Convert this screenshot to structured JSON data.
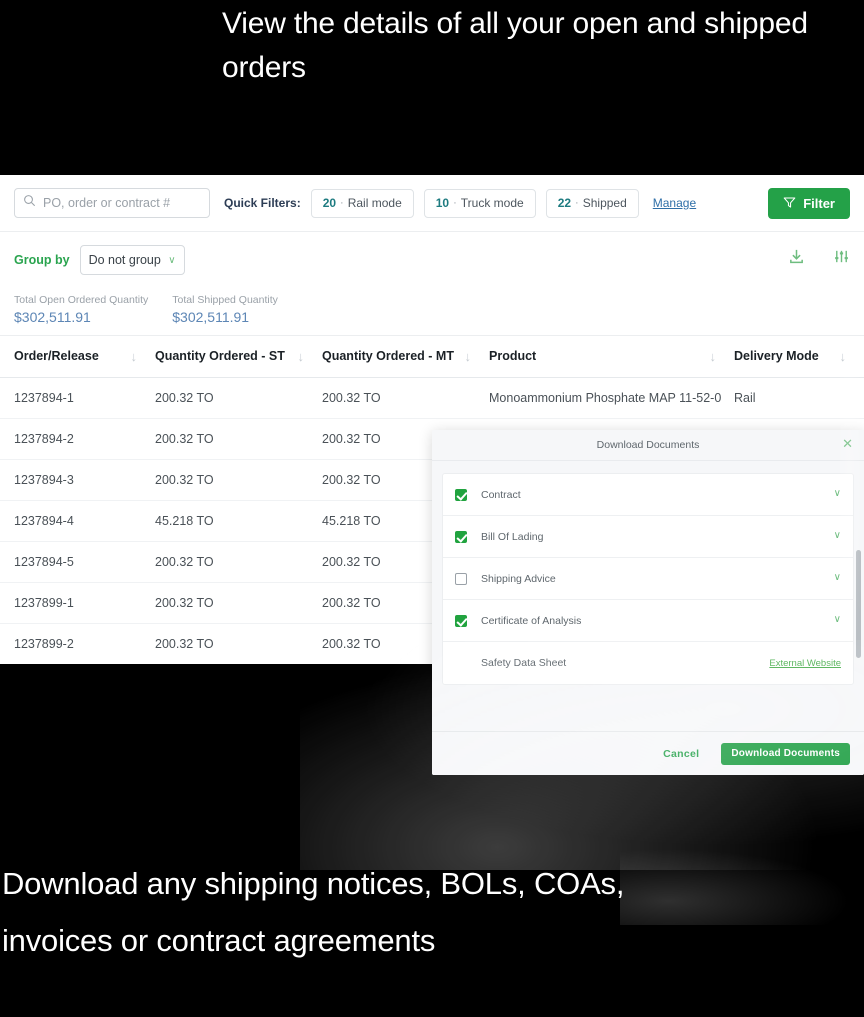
{
  "captions": {
    "top": "View the details of all your open and shipped orders",
    "bottom": "Download any shipping notices, BOLs, COAs, invoices or contract agreements"
  },
  "colors": {
    "brand_green": "#24a148",
    "link_green": "#4caf50",
    "link_blue": "#2f6fa8",
    "total_blue": "#5d86b5",
    "count_teal": "#1d7b80"
  },
  "toolbar": {
    "search": {
      "placeholder": "PO, order or contract #",
      "value": "",
      "icon": "search-icon"
    },
    "quick_filters_label": "Quick Filters:",
    "quick_filters": [
      {
        "count": "20",
        "sep": "·",
        "label": "Rail mode"
      },
      {
        "count": "10",
        "sep": "·",
        "label": "Truck mode"
      },
      {
        "count": "22",
        "sep": "·",
        "label": "Shipped"
      }
    ],
    "manage_link": "Manage",
    "filter_button": "Filter"
  },
  "groupbar": {
    "label": "Group by",
    "select_value": "Do not group",
    "chevron": "∨",
    "download_icon": "download-icon",
    "settings_icon": "column-settings-icon"
  },
  "totals": [
    {
      "label": "Total Open Ordered Quantity",
      "value": "$302,511.91"
    },
    {
      "label": "Total Shipped Quantity",
      "value": "$302,511.91"
    }
  ],
  "table": {
    "columns": [
      {
        "label": "Order/Release",
        "sort": "↓"
      },
      {
        "label": "Quantity Ordered - ST",
        "sort": "↓"
      },
      {
        "label": "Quantity Ordered - MT",
        "sort": "↓"
      },
      {
        "label": "Product",
        "sort": "↓"
      },
      {
        "label": "Delivery Mode",
        "sort": "↓"
      }
    ],
    "rows": [
      {
        "order": "1237894-1",
        "qty_st": "200.32 TO",
        "qty_mt": "200.32 TO",
        "product": "Monoammonium Phosphate MAP 11-52-0",
        "mode": "Rail"
      },
      {
        "order": "1237894-2",
        "qty_st": "200.32 TO",
        "qty_mt": "200.32 TO",
        "product": "",
        "mode": ""
      },
      {
        "order": "1237894-3",
        "qty_st": "200.32 TO",
        "qty_mt": "200.32 TO",
        "product": "",
        "mode": ""
      },
      {
        "order": "1237894-4",
        "qty_st": "45.218 TO",
        "qty_mt": "45.218 TO",
        "product": "",
        "mode": ""
      },
      {
        "order": "1237894-5",
        "qty_st": "200.32 TO",
        "qty_mt": "200.32 TO",
        "product": "",
        "mode": ""
      },
      {
        "order": "1237899-1",
        "qty_st": "200.32 TO",
        "qty_mt": "200.32 TO",
        "product": "",
        "mode": ""
      },
      {
        "order": "1237899-2",
        "qty_st": "200.32 TO",
        "qty_mt": "200.32 TO",
        "product": "",
        "mode": ""
      }
    ]
  },
  "modal": {
    "title": "Download Documents",
    "close_icon": "close-icon",
    "documents": [
      {
        "label": "Contract",
        "checked": true,
        "chevron": "∨"
      },
      {
        "label": "Bill Of Lading",
        "checked": true,
        "chevron": "∨"
      },
      {
        "label": "Shipping Advice",
        "checked": false,
        "chevron": "∨"
      },
      {
        "label": "Certificate of Analysis",
        "checked": true,
        "chevron": "∨"
      }
    ],
    "safety_row": {
      "label": "Safety Data Sheet",
      "link": "External Website"
    },
    "cancel_button": "Cancel",
    "download_button": "Download Documents"
  }
}
